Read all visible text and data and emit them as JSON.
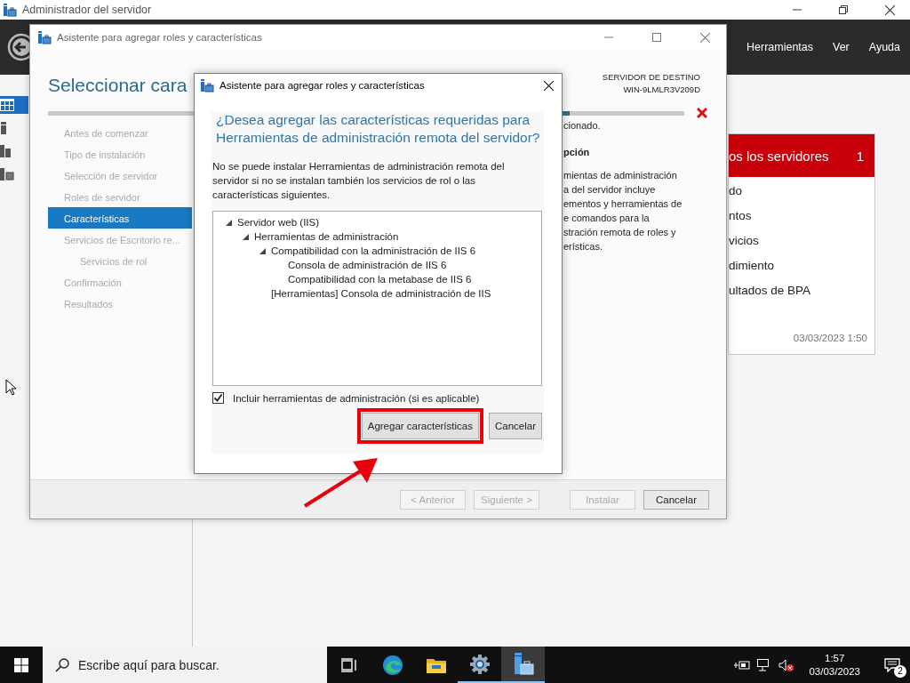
{
  "server_manager": {
    "title": "Administrador del servidor",
    "menu": [
      "Herramientas",
      "Ver",
      "Ayuda"
    ],
    "nav_icons": [
      {
        "kind": "dashboard",
        "selected": true
      },
      {
        "kind": "server",
        "selected": false
      },
      {
        "kind": "servers",
        "selected": false
      },
      {
        "kind": "storage",
        "selected": false
      }
    ],
    "tile": {
      "title": "os los servidores",
      "count": "1",
      "items": [
        "do",
        "ntos",
        "vicios",
        "dimiento",
        "ultados de BPA"
      ],
      "timestamp": "03/03/2023 1:50"
    }
  },
  "wizard": {
    "title": "Asistente para agregar roles y características",
    "heading": "Seleccionar cara",
    "destination_label": "SERVIDOR DE DESTINO",
    "destination_server": "WIN-9LMLR3V209D",
    "steps": [
      {
        "label": "Antes de comenzar",
        "selected": false
      },
      {
        "label": "Tipo de instalación",
        "selected": false
      },
      {
        "label": "Selección de servidor",
        "selected": false
      },
      {
        "label": "Roles de servidor",
        "selected": false
      },
      {
        "label": "Características",
        "selected": true
      },
      {
        "label": "Servicios de Escritorio re...",
        "selected": false,
        "children": [
          {
            "label": "Servicios de rol",
            "selected": false
          }
        ]
      },
      {
        "label": "Confirmación",
        "selected": false
      },
      {
        "label": "Resultados",
        "selected": false
      }
    ],
    "progress": {
      "level": 0.82
    },
    "content_line": "cionado.",
    "description_heading": "pción",
    "description_lines": [
      "mientas de administración",
      "a del servidor incluye",
      "ementos y herramientas de",
      "e comandos para la",
      "stración remota de roles y",
      "erísticas."
    ],
    "buttons": [
      {
        "label": "< Anterior",
        "disabled": true
      },
      {
        "label": "Siguiente >",
        "disabled": true
      },
      {
        "label": "Instalar",
        "disabled": true
      },
      {
        "label": "Cancelar",
        "disabled": false
      }
    ]
  },
  "dialog": {
    "title": "Asistente para agregar roles y características",
    "heading": "¿Desea agregar las características requeridas para Herramientas de administración remota del servidor?",
    "message": "No se puede instalar Herramientas de administración remota del servidor si no se instalan también los servicios de rol o las características siguientes.",
    "tree": [
      {
        "label": "Servidor web (IIS)",
        "expanded": true,
        "children": [
          {
            "label": "Herramientas de administración",
            "expanded": true,
            "children": [
              {
                "label": "Compatibilidad con la administración de IIS 6",
                "expanded": true,
                "children": [
                  {
                    "label": "Consola de administración de IIS 6"
                  },
                  {
                    "label": "Compatibilidad con la metabase de IIS 6"
                  }
                ]
              },
              {
                "label": "[Herramientas] Consola de administración de IIS"
              }
            ]
          }
        ]
      }
    ],
    "include_tools": {
      "label": "Incluir herramientas de administración (si es aplicable)",
      "checked": true
    },
    "buttons": [
      {
        "label": "Agregar características",
        "highlighted": true
      },
      {
        "label": "Cancelar",
        "highlighted": false
      }
    ]
  },
  "taskbar": {
    "search_placeholder": "Escribe aquí para buscar.",
    "apps": [
      {
        "kind": "task-view",
        "running": false,
        "active": false
      },
      {
        "kind": "edge",
        "running": false,
        "active": false
      },
      {
        "kind": "explorer",
        "running": false,
        "active": false
      },
      {
        "kind": "settings",
        "running": true,
        "active": false
      },
      {
        "kind": "server-manager",
        "running": true,
        "active": true
      }
    ],
    "time": "1:57",
    "date": "03/03/2023",
    "notification_count": "2"
  }
}
